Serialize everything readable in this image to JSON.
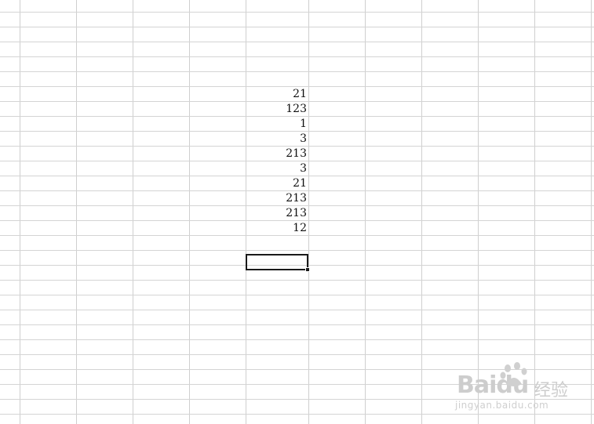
{
  "sheet": {
    "column_d_values": [
      "21",
      "123",
      "1",
      "3",
      "213",
      "3",
      "21",
      "213",
      "213",
      "12"
    ]
  },
  "watermark": {
    "brand": "Baidu",
    "suffix": "经验",
    "url": "jingyan.baidu.com"
  },
  "colors": {
    "gridline": "#d4d4d4",
    "selection_border": "#1a1a1a",
    "watermark": "#cdcdcd"
  }
}
